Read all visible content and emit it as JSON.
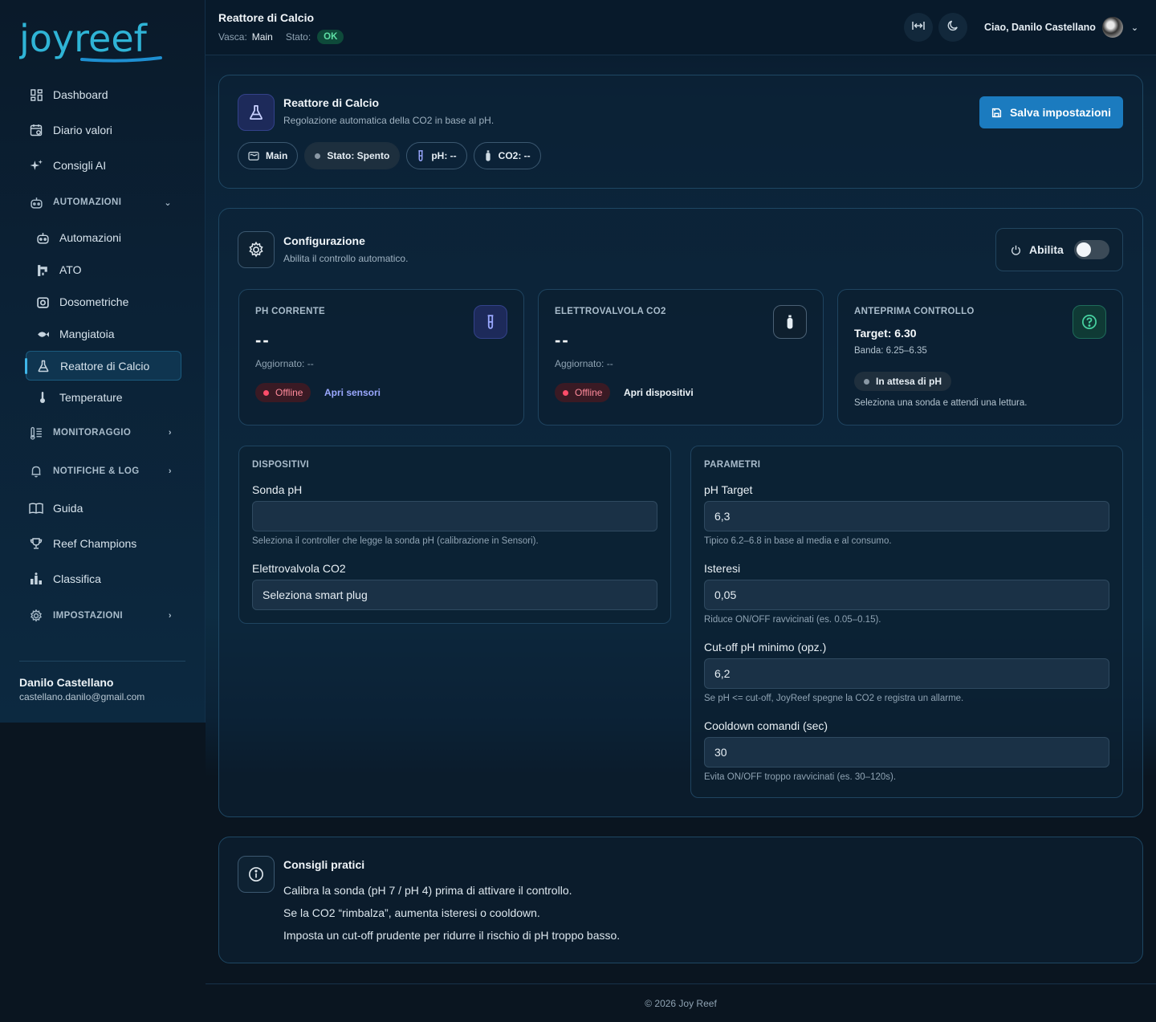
{
  "brand": {
    "logo_text": "joyreef"
  },
  "sidebar": {
    "items": [
      {
        "label": "Dashboard",
        "icon": "dashboard-icon"
      },
      {
        "label": "Diario valori",
        "icon": "calendar-icon"
      },
      {
        "label": "Consigli AI",
        "icon": "sparkles-icon"
      }
    ],
    "automazioni": {
      "label": "AUTOMAZIONI",
      "children": [
        "Automazioni",
        "ATO",
        "Dosometriche",
        "Mangiatoia",
        "Reattore di Calcio",
        "Temperature"
      ],
      "active": "Reattore di Calcio"
    },
    "monitoraggio_label": "MONITORAGGIO",
    "notifiche_label": "NOTIFICHE & LOG",
    "guida_label": "Guida",
    "champions_label": "Reef Champions",
    "classifica_label": "Classifica",
    "impostazioni_label": "IMPOSTAZIONI",
    "user_name": "Danilo Castellano",
    "user_email": "castellano.danilo@gmail.com"
  },
  "header": {
    "title": "Reattore di Calcio",
    "vasca_label": "Vasca:",
    "vasca_value": "Main",
    "stato_label": "Stato:",
    "stato_value": "OK",
    "greeting": "Ciao, Danilo Castellano"
  },
  "top_card": {
    "title": "Reattore di Calcio",
    "subtitle": "Regolazione automatica della CO2 in base al pH.",
    "save_label": "Salva impostazioni",
    "pills": {
      "tank": "Main",
      "stato": "Stato: Spento",
      "ph": "pH: --",
      "co2": "CO2: --"
    }
  },
  "config": {
    "title": "Configurazione",
    "subtitle": "Abilita il controllo automatico.",
    "enable_label": "Abilita",
    "enabled": false,
    "ph_card": {
      "label": "pH CORRENTE",
      "value": "--",
      "updated": "Aggiornato: --",
      "status": "Offline",
      "link": "Apri sensori"
    },
    "valve_card": {
      "label": "ELETTROVALVOLA CO2",
      "value": "--",
      "updated": "Aggiornato: --",
      "status": "Offline",
      "link": "Apri dispositivi"
    },
    "preview_card": {
      "label": "ANTEPRIMA CONTROLLO",
      "target": "Target: 6.30",
      "band": "Banda: 6.25–6.35",
      "status": "In attesa di pH",
      "note": "Seleziona una sonda e attendi una lettura."
    },
    "devices": {
      "head": "DISPOSITIVI",
      "probe_label": "Sonda pH",
      "probe_value": "",
      "probe_help": "Seleziona il controller che legge la sonda pH (calibrazione in Sensori).",
      "valve_label": "Elettrovalvola CO2",
      "valve_value": "Seleziona smart plug"
    },
    "params": {
      "head": "PARAMETRI",
      "ph_target_label": "pH Target",
      "ph_target_value": "6,3",
      "ph_target_help": "Tipico 6.2–6.8 in base al media e al consumo.",
      "hyst_label": "Isteresi",
      "hyst_value": "0,05",
      "hyst_help": "Riduce ON/OFF ravvicinati (es. 0.05–0.15).",
      "cutoff_label": "Cut-off pH minimo (opz.)",
      "cutoff_value": "6,2",
      "cutoff_help": "Se pH <= cut-off, JoyReef spegne la CO2 e registra un allarme.",
      "cooldown_label": "Cooldown comandi (sec)",
      "cooldown_value": "30",
      "cooldown_help": "Evita ON/OFF troppo ravvicinati (es. 30–120s)."
    }
  },
  "tips": {
    "title": "Consigli pratici",
    "items": [
      "Calibra la sonda (pH 7 / pH 4) prima di attivare il controllo.",
      "Se la CO2 “rimbalza”, aumenta isteresi o cooldown.",
      "Imposta un cut-off prudente per ridurre il rischio di pH troppo basso."
    ]
  },
  "footer": {
    "text": "© 2026 Joy Reef"
  },
  "colors": {
    "accent": "#1b7bbf",
    "ok": "#5ee0a5",
    "offline": "#ff4d6a",
    "link": "#9aa8ff"
  }
}
